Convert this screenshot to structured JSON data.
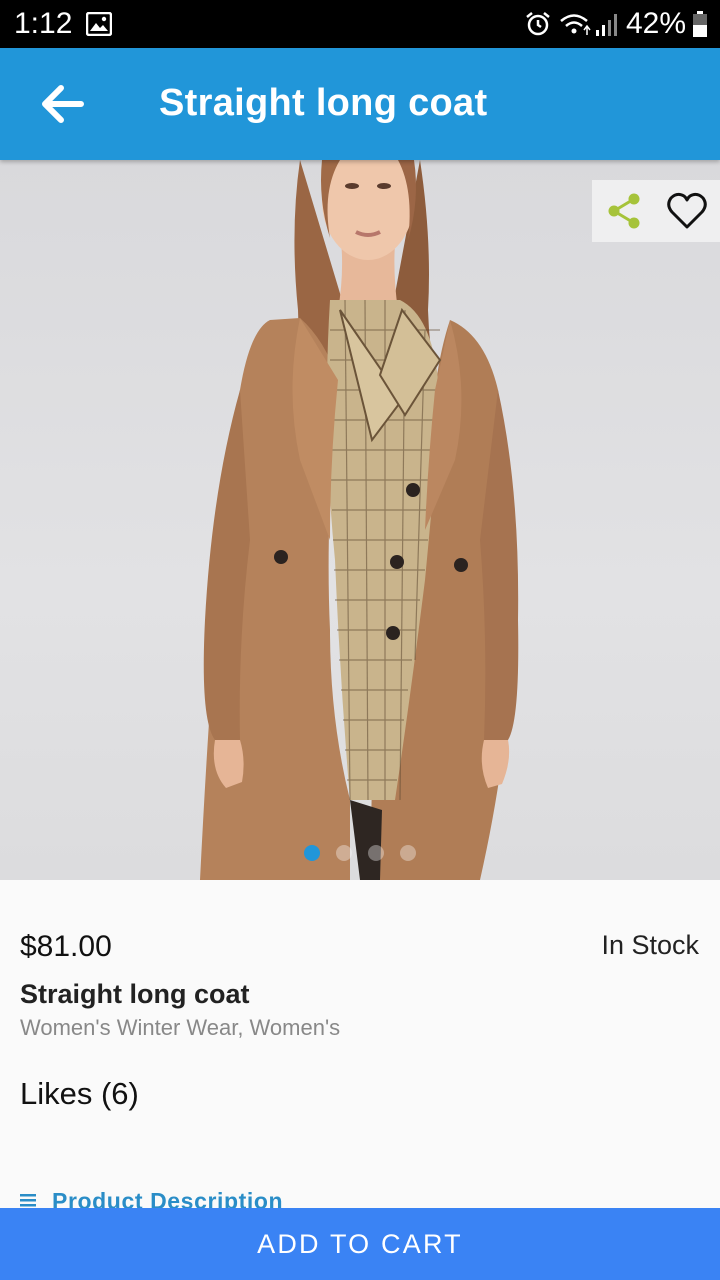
{
  "status_bar": {
    "time": "1:12",
    "battery": "42%"
  },
  "app_bar": {
    "title": "Straight long coat",
    "back_icon": "arrow-left-icon",
    "color": "#2196d9"
  },
  "gallery": {
    "image": "product-photo-woman-in-camel-coat",
    "page_count": 4,
    "active_index": 0,
    "share_icon": "share-icon",
    "favorite_icon": "heart-outline-icon",
    "share_color": "#a6c33a"
  },
  "product": {
    "price": "$81.00",
    "stock": "In Stock",
    "name": "Straight long coat",
    "categories": "Women's Winter Wear, Women's",
    "likes": "Likes (6)",
    "description_link": "Product Description"
  },
  "actions": {
    "add_to_cart": "ADD TO CART",
    "button_color": "#3a83f4"
  }
}
